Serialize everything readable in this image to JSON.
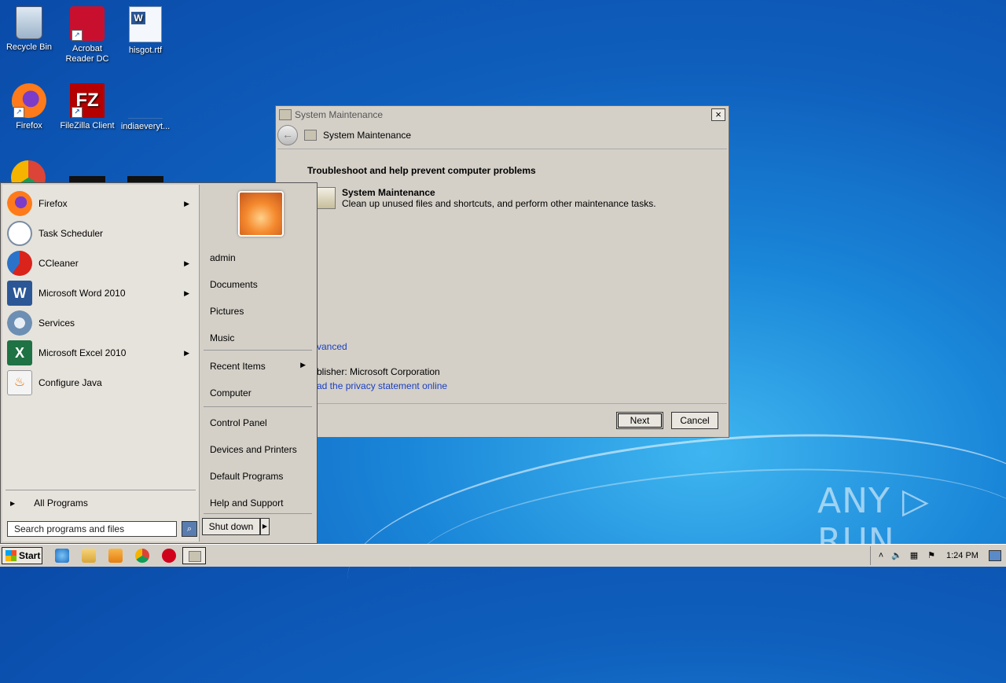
{
  "desktop": {
    "icons": [
      {
        "label": "Recycle Bin"
      },
      {
        "label": "Acrobat Reader DC"
      },
      {
        "label": "hisgot.rtf"
      },
      {
        "label": "Firefox"
      },
      {
        "label": "FileZilla Client"
      },
      {
        "label": "indiaeveryt..."
      }
    ]
  },
  "window": {
    "title": "System Maintenance",
    "nav_title": "System Maintenance",
    "heading": "Troubleshoot and help prevent computer problems",
    "item_title": "System Maintenance",
    "item_desc": "Clean up unused files and shortcuts, and perform other maintenance tasks.",
    "advanced": "vanced",
    "publisher": "blisher:  Microsoft Corporation",
    "privacy": "ad the privacy statement online",
    "next_label": "Next",
    "cancel_label": "Cancel"
  },
  "startmenu": {
    "programs": [
      {
        "label": "Firefox"
      },
      {
        "label": "Task Scheduler"
      },
      {
        "label": "CCleaner"
      },
      {
        "label": "Microsoft Word 2010"
      },
      {
        "label": "Services"
      },
      {
        "label": "Microsoft Excel 2010"
      },
      {
        "label": "Configure Java"
      }
    ],
    "all_programs": "All Programs",
    "search_placeholder": "Search programs and files",
    "right": {
      "user": "admin",
      "documents": "Documents",
      "pictures": "Pictures",
      "music": "Music",
      "recent": "Recent Items",
      "computer": "Computer",
      "control_panel": "Control Panel",
      "devices": "Devices and Printers",
      "default_programs": "Default Programs",
      "help": "Help and Support"
    },
    "shutdown": "Shut down"
  },
  "taskbar": {
    "start": "Start",
    "clock": "1:24 PM"
  },
  "watermark": "ANY ▷ RUN"
}
